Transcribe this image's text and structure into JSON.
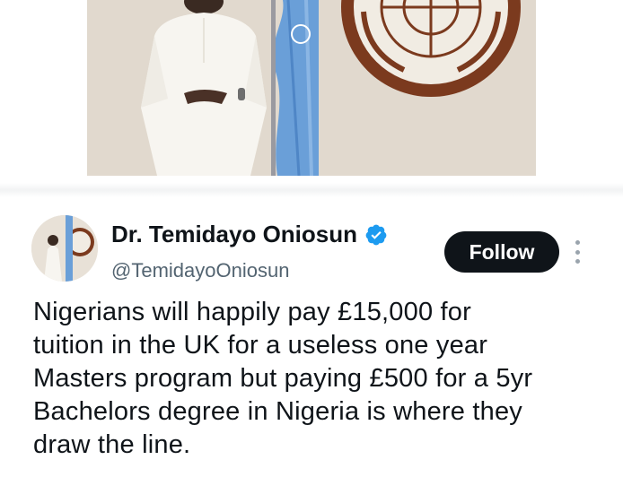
{
  "author": {
    "display_name": "Dr. Temidayo Oniosun",
    "handle": "@TemidayoOniosun",
    "verified_icon": "verified-badge-icon",
    "verified_color": "#1d9bf0"
  },
  "actions": {
    "follow_label": "Follow",
    "more_icon": "more-vertical-icon"
  },
  "tweet": {
    "text_lines": [
      "Nigerians will happily pay £15,000 for",
      "tuition in the UK for a useless one year",
      "Masters program but paying £500 for a 5yr",
      "Bachelors degree in Nigeria is where they",
      "draw the line."
    ]
  },
  "colors": {
    "text": "#0f1419",
    "secondary": "#536471",
    "button_bg": "#0f1419",
    "button_text": "#ffffff"
  }
}
